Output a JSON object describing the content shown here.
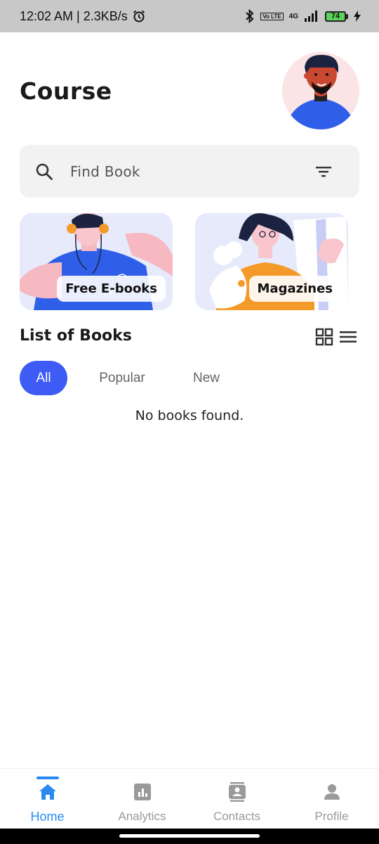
{
  "status": {
    "time_speed": "12:02 AM | 2.3KB/s",
    "network": "4G",
    "volte": "Vo LTE",
    "battery": "74"
  },
  "header": {
    "title": "Course"
  },
  "search": {
    "placeholder": "Find Book"
  },
  "categories": [
    {
      "label": "Free E-books"
    },
    {
      "label": "Magazines"
    }
  ],
  "books": {
    "title": "List of Books",
    "filters": [
      "All",
      "Popular",
      "New"
    ],
    "selected_filter": "All",
    "empty_message": "No books found."
  },
  "nav": {
    "items": [
      {
        "label": "Home",
        "icon": "home-icon",
        "active": true
      },
      {
        "label": "Analytics",
        "icon": "analytics-icon",
        "active": false
      },
      {
        "label": "Contacts",
        "icon": "contacts-icon",
        "active": false
      },
      {
        "label": "Profile",
        "icon": "profile-icon",
        "active": false
      }
    ]
  },
  "colors": {
    "accent": "#3f5bf6",
    "nav_active": "#2a8af1",
    "card_bg": "#e7eafb"
  }
}
